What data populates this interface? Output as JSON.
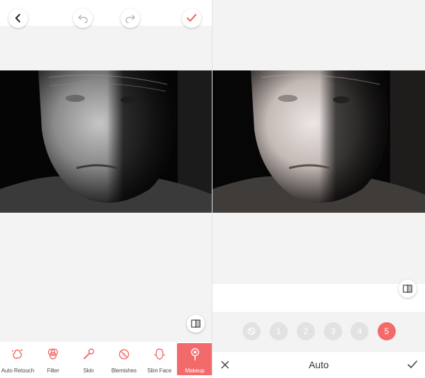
{
  "colors": {
    "accent": "#f36a6a",
    "background": "#f3f3f3",
    "inactive_level": "#e2e2e2"
  },
  "left": {
    "top_bar": {
      "back_icon": "chevron-left-icon",
      "undo_icon": "undo-icon",
      "redo_icon": "redo-icon",
      "confirm_icon": "checkmark-icon"
    },
    "tools": [
      {
        "label": "Auto Retouch",
        "icon": "auto-retouch-icon",
        "active": false
      },
      {
        "label": "Filter",
        "icon": "filter-icon",
        "active": false
      },
      {
        "label": "Skin",
        "icon": "skin-brush-icon",
        "active": false
      },
      {
        "label": "Blemishes",
        "icon": "blemishes-icon",
        "active": false
      },
      {
        "label": "Slim Face",
        "icon": "slim-face-icon",
        "active": false
      },
      {
        "label": "Makeup",
        "icon": "makeup-icon",
        "active": true
      }
    ]
  },
  "right": {
    "levels": {
      "disabled_icon": "none-icon",
      "items": [
        "1",
        "2",
        "3",
        "4",
        "5"
      ],
      "selected": "5"
    },
    "bottom_bar": {
      "title": "Auto",
      "cancel_icon": "close-icon",
      "confirm_icon": "checkmark-icon"
    }
  }
}
